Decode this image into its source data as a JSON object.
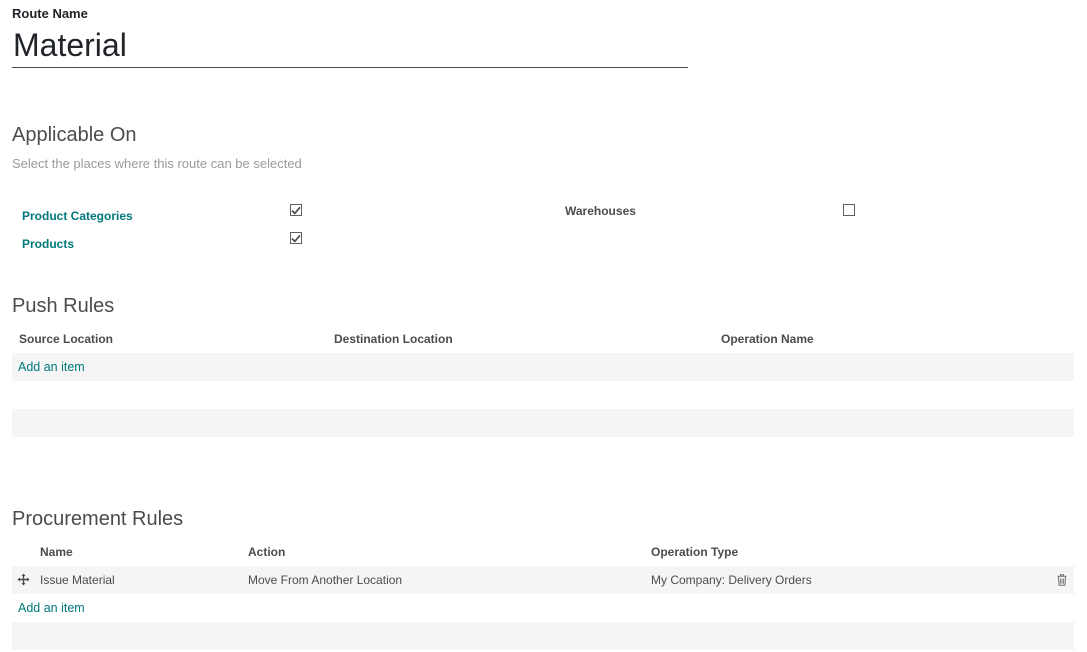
{
  "route": {
    "label": "Route Name",
    "value": "Material"
  },
  "applicable": {
    "title": "Applicable On",
    "help": "Select the places where this route can be selected",
    "product_categories": {
      "label": "Product Categories",
      "checked": true
    },
    "products": {
      "label": "Products",
      "checked": true
    },
    "warehouses": {
      "label": "Warehouses",
      "checked": false
    }
  },
  "push_rules": {
    "title": "Push Rules",
    "columns": [
      "Source Location",
      "Destination Location",
      "Operation Name"
    ],
    "add_label": "Add an item",
    "rows": []
  },
  "procurement_rules": {
    "title": "Procurement Rules",
    "columns": [
      "Name",
      "Action",
      "Operation Type"
    ],
    "add_label": "Add an item",
    "rows": [
      {
        "name": "Issue Material",
        "action": "Move From Another Location",
        "operation_type": "My Company: Delivery Orders"
      }
    ]
  },
  "colors": {
    "link": "#00787a",
    "band": "#f5f5f5",
    "text": "#4c4c4c"
  },
  "icons": {
    "row_handle": "drag-handle-icon",
    "row_delete": "trash-icon",
    "checkbox_check": "checkmark-icon"
  }
}
